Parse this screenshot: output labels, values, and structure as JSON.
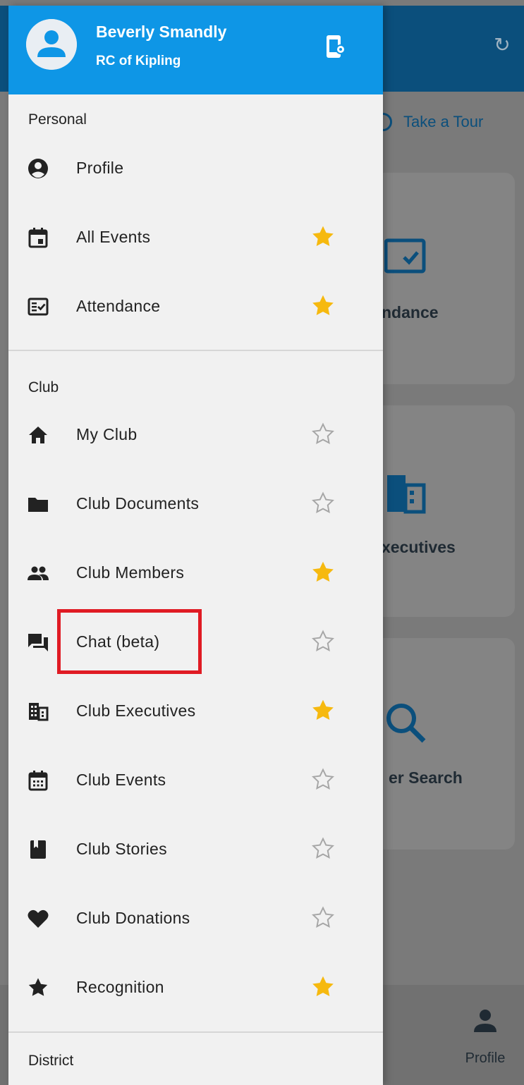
{
  "colors": {
    "header_bg": "#0e96e6",
    "drawer_bg": "#f1f1f1",
    "star_filled": "#f6b90f",
    "star_outline": "#a6a6a6",
    "highlight": "#e01b24",
    "background_appbar": "#0b4f7c"
  },
  "header": {
    "user_name": "Beverly Smandly",
    "club_name": "RC of Kipling",
    "avatar_icon": "person-icon",
    "settings_icon": "device-settings-icon"
  },
  "sections": {
    "personal": "Personal",
    "club": "Club",
    "district": "District"
  },
  "menu": {
    "profile": {
      "label": "Profile",
      "icon": "account-circle-icon",
      "favorite": null
    },
    "all_events": {
      "label": "All Events",
      "icon": "event-icon",
      "favorite": true
    },
    "attendance": {
      "label": "Attendance",
      "icon": "fact-check-icon",
      "favorite": true
    },
    "my_club": {
      "label": "My Club",
      "icon": "home-icon",
      "favorite": false
    },
    "club_documents": {
      "label": "Club Documents",
      "icon": "folder-icon",
      "favorite": false
    },
    "club_members": {
      "label": "Club Members",
      "icon": "people-icon",
      "favorite": true
    },
    "chat": {
      "label": "Chat (beta)",
      "icon": "forum-icon",
      "favorite": false
    },
    "club_executives": {
      "label": "Club Executives",
      "icon": "business-icon",
      "favorite": true
    },
    "club_events": {
      "label": "Club Events",
      "icon": "calendar-icon",
      "favorite": false
    },
    "club_stories": {
      "label": "Club Stories",
      "icon": "book-icon",
      "favorite": false
    },
    "club_donations": {
      "label": "Club Donations",
      "icon": "heart-icon",
      "favorite": false
    },
    "recognition": {
      "label": "Recognition",
      "icon": "star-icon",
      "favorite": true
    }
  },
  "background": {
    "take_a_tour": "Take a Tour",
    "card_attendance": "ndance",
    "card_executives": "xecutives",
    "card_search": "er Search",
    "bottom_profile": "Profile"
  }
}
